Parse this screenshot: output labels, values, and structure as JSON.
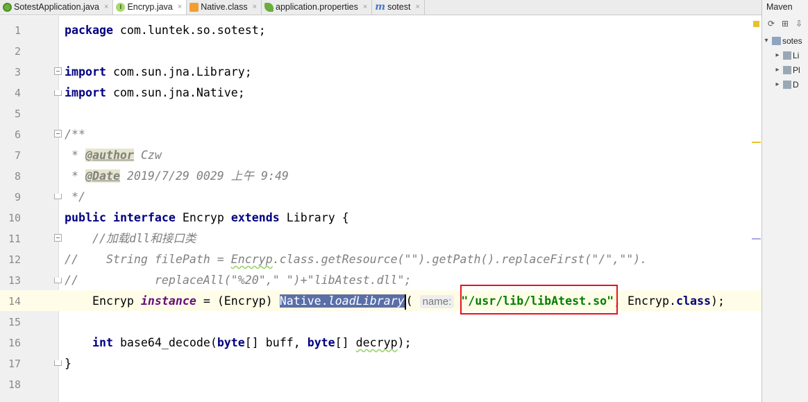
{
  "tabs": [
    {
      "label": "SotestApplication.java",
      "icon": "spring-icon",
      "active": false
    },
    {
      "label": "Encryp.java",
      "icon": "interface-icon",
      "active": true
    },
    {
      "label": "Native.class",
      "icon": "class-icon",
      "active": false
    },
    {
      "label": "application.properties",
      "icon": "properties-icon",
      "active": false
    },
    {
      "label": "sotest",
      "icon": "maven-m-icon",
      "active": false
    }
  ],
  "tab_close_glyph": "×",
  "interface_glyph": "I",
  "maven_glyph": "m",
  "line_numbers": [
    "1",
    "2",
    "3",
    "4",
    "5",
    "6",
    "7",
    "8",
    "9",
    "10",
    "11",
    "12",
    "13",
    "14",
    "15",
    "16",
    "17",
    "18"
  ],
  "code": {
    "l1_kw": "package",
    "l1_rest": " com.luntek.so.sotest;",
    "l3_kw": "import",
    "l3_rest": " com.sun.jna.Library;",
    "l4_kw": "import",
    "l4_rest": " com.sun.jna.Native;",
    "l6": "/**",
    "l7_pre": " * ",
    "l7_tag": "@author",
    "l7_text": " Czw",
    "l8_pre": " * ",
    "l8_tag": "@Date",
    "l8_text": " 2019/7/29 0029 上午 9:49",
    "l9": " */",
    "l10_kw1": "public",
    "l10_kw2": "interface",
    "l10_name": "Encryp",
    "l10_kw3": "extends",
    "l10_rest": " Library {",
    "l11": "    //加载dll和接口类",
    "l12_a": "//    String filePath = ",
    "l12_b": "Encryp",
    "l12_c": ".class.getResource(\"\").getPath().replaceFirst(\"/\",\"\").",
    "l13": "//           replaceAll(\"%20\",\" \")+\"libAtest.dll\";",
    "l14_a": "    Encryp ",
    "l14_field": "instance",
    "l14_b": " = (Encryp) ",
    "l14_sel_a": "Native.",
    "l14_sel_b": "loadLibrary",
    "l14_paren": "(",
    "l14_hint": "name:",
    "l14_str": "\"/usr/lib/libAtest.so\"",
    "l14_c": ", Encryp.",
    "l14_kw": "class",
    "l14_d": ");",
    "l16_kw1": "int",
    "l16_a": " base64_decode(",
    "l16_kw2": "byte",
    "l16_b": "[] buff, ",
    "l16_kw3": "byte",
    "l16_c": "[] ",
    "l16_d": "decryp",
    "l16_e": ");",
    "l17": "}"
  },
  "maven": {
    "title": "Maven",
    "tools": [
      "refresh-icon",
      "add-icon",
      "download-icon"
    ],
    "tree": [
      {
        "label": "sotes",
        "expanded": true
      },
      {
        "label": "Li",
        "expanded": false
      },
      {
        "label": "Pl",
        "expanded": false
      },
      {
        "label": "D",
        "expanded": false
      }
    ]
  },
  "colors": {
    "keyword": "#000080",
    "string": "#008000",
    "comment": "#808080",
    "field": "#660e7a",
    "selection": "#5a6fa8",
    "highlight_box": "#e8121d"
  }
}
